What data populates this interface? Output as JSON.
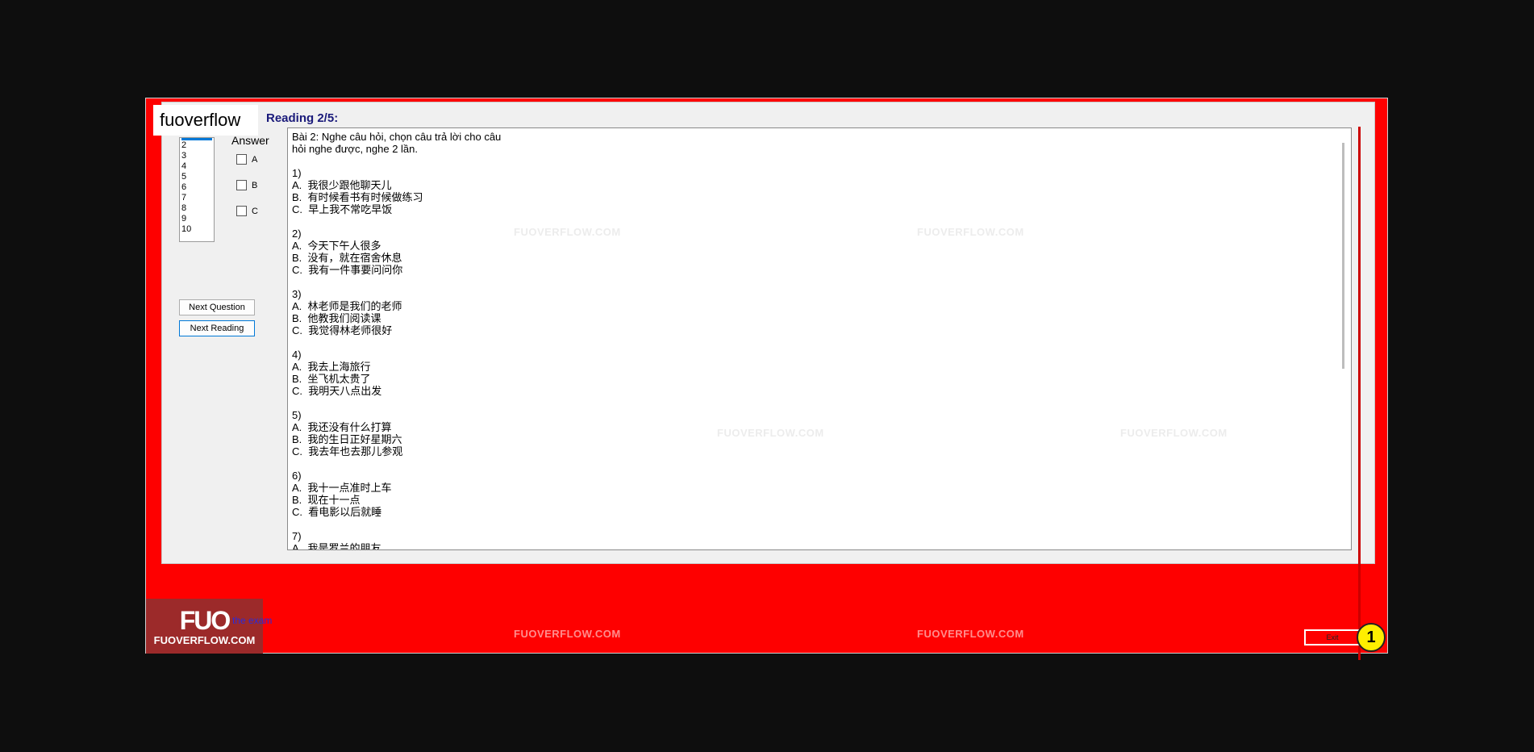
{
  "logo_text": "fuoverflow",
  "question_list": [
    "2",
    "3",
    "4",
    "5",
    "6",
    "7",
    "8",
    "9",
    "10"
  ],
  "answer": {
    "label": "Answer",
    "options": [
      "A",
      "B",
      "C"
    ]
  },
  "buttons": {
    "next_question": "Next Question",
    "next_reading": "Next Reading",
    "exit": "Exit"
  },
  "reading_title": "Reading 2/5:",
  "reading_text": "Bài 2: Nghe câu hỏi, chọn câu trả lời cho câu\nhỏi nghe được, nghe 2 lần.\n\n1)\nA.  我很少跟他聊天儿\nB.  有时候看书有时候做练习\nC.  早上我不常吃早饭\n\n2)\nA.  今天下午人很多\nB.  没有，就在宿舍休息\nC.  我有一件事要问问你\n\n3)\nA.  林老师是我们的老师\nB.  他教我们阅读课\nC.  我觉得林老师很好\n\n4)\nA.  我去上海旅行\nB.  坐飞机太贵了\nC.  我明天八点出发\n\n5)\nA.  我还没有什么打算\nB.  我的生日正好星期六\nC.  我去年也去那儿参观\n\n6)\nA.  我十一点准时上车\nB.  现在十一点\nC.  看电影以后就睡\n\n7)\nA.  我是罗兰的朋友",
  "watermark": "FUOVERFLOW.COM",
  "brand": {
    "big": "FUO",
    "small": "FUOVERFLOW.COM"
  },
  "finish_link": "the exam",
  "badge_number": "1"
}
